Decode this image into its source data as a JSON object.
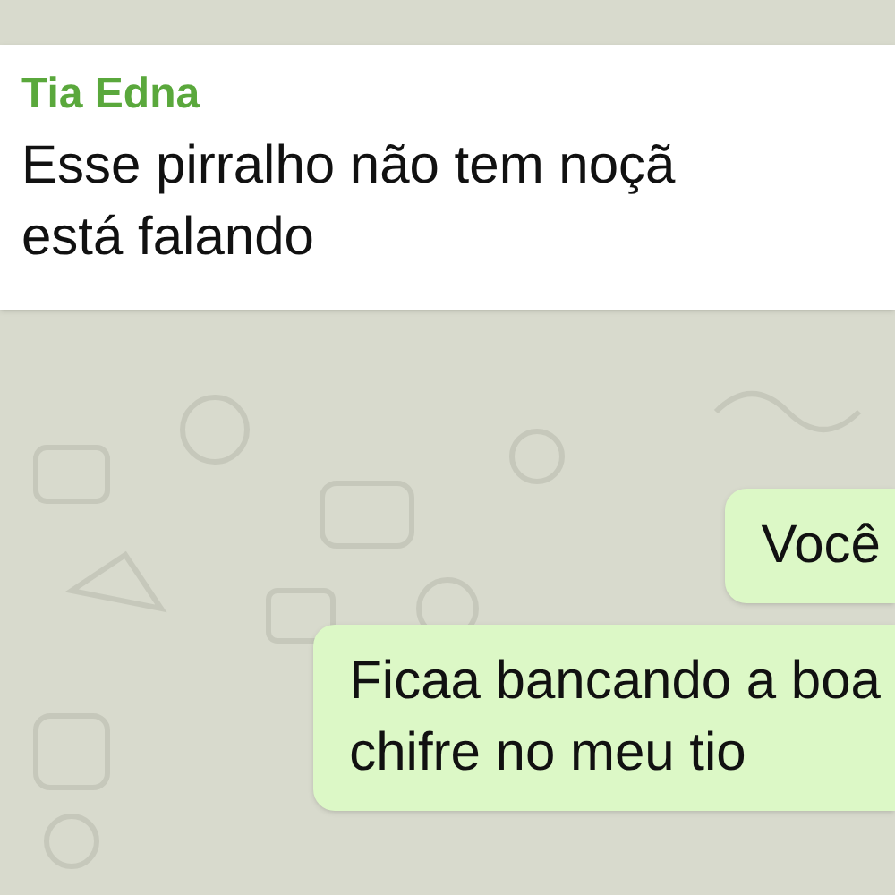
{
  "messages": [
    {
      "kind": "incoming",
      "sender": "Tia Edna",
      "lines": [
        "Esse pirralho não tem noçã",
        "está falando"
      ]
    },
    {
      "kind": "outgoing",
      "lines": [
        "Você"
      ]
    },
    {
      "kind": "outgoing",
      "lines": [
        "Ficaa bancando a boa",
        "chifre no meu tio"
      ]
    }
  ]
}
